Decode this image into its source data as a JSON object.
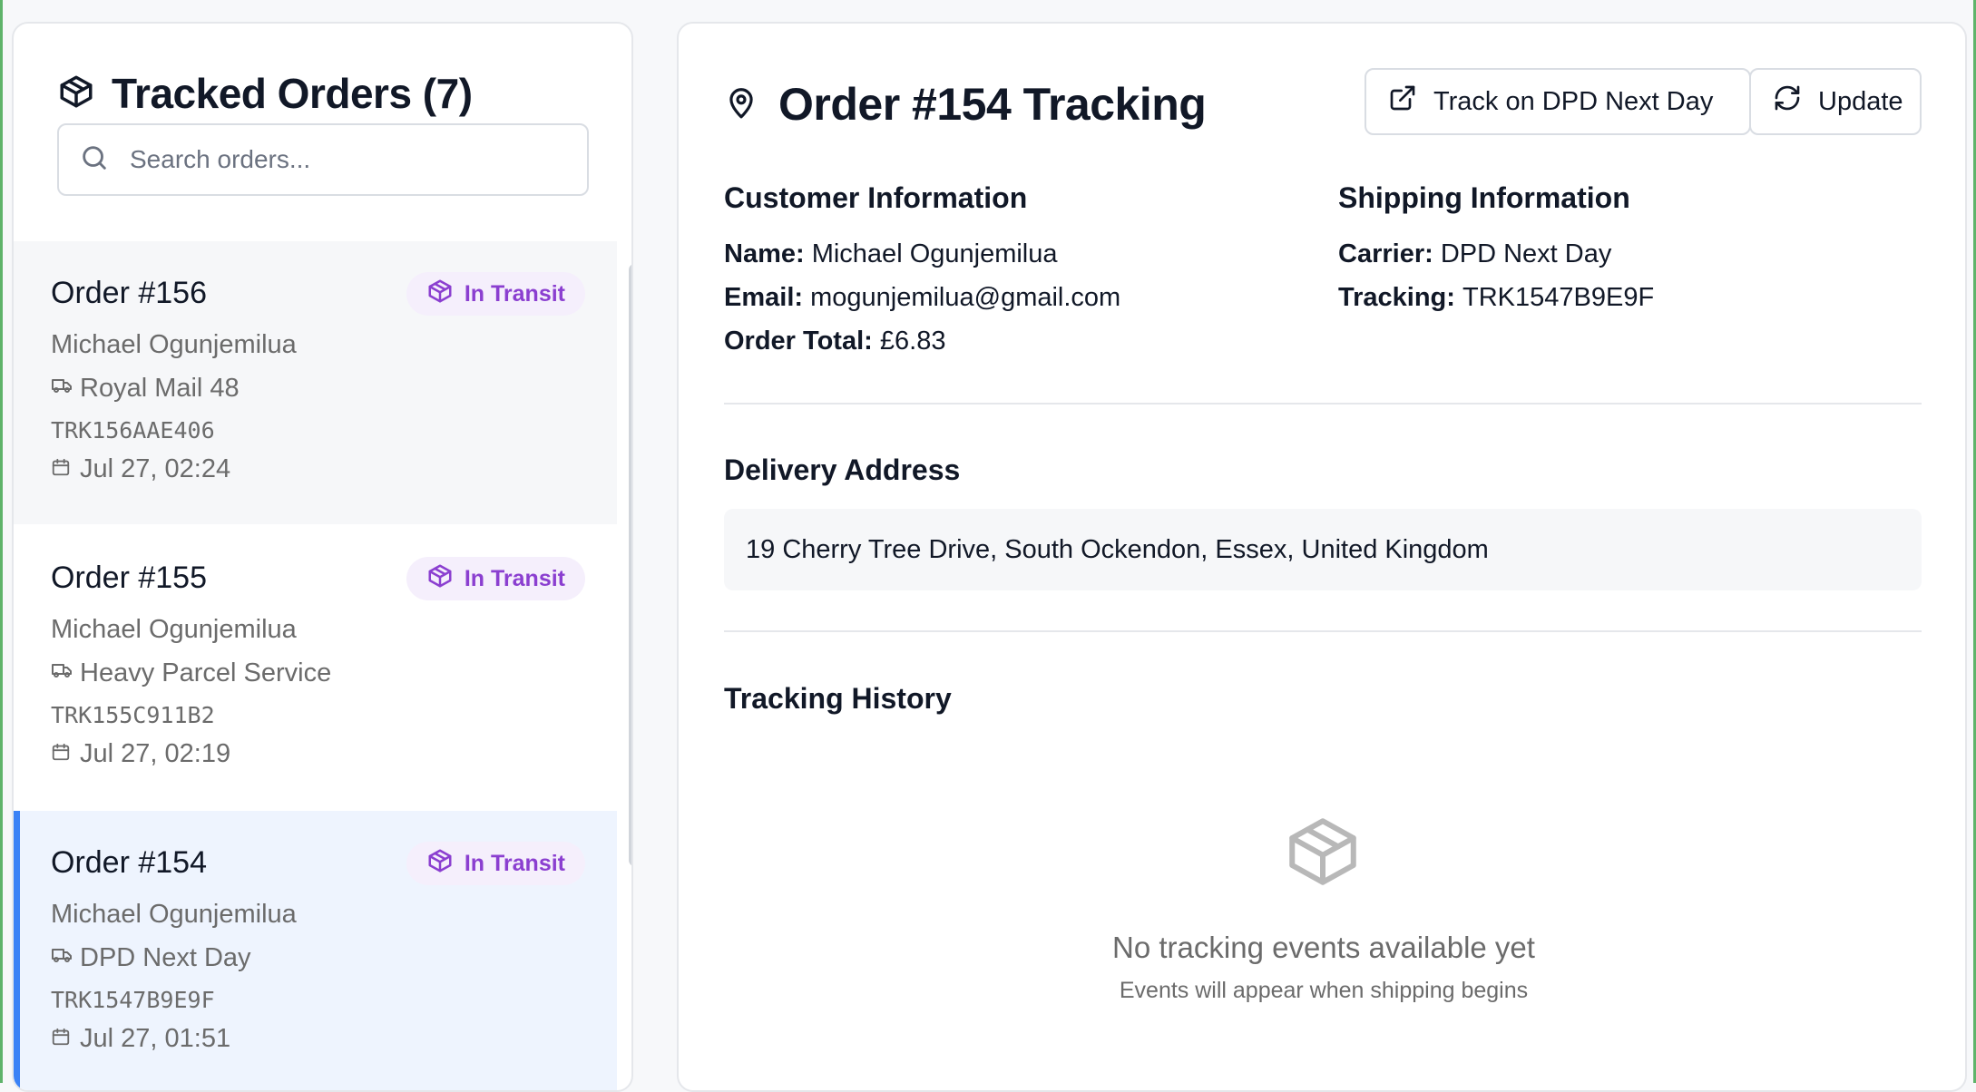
{
  "sidebar": {
    "title": "Tracked Orders (7)",
    "search_placeholder": "Search orders...",
    "orders": [
      {
        "number": "Order #156",
        "status": "In Transit",
        "customer": "Michael Ogunjemilua",
        "carrier": "Royal Mail 48",
        "tracking": "TRK156AAE406",
        "date": "Jul 27, 02:24"
      },
      {
        "number": "Order #155",
        "status": "In Transit",
        "customer": "Michael Ogunjemilua",
        "carrier": "Heavy Parcel Service",
        "tracking": "TRK155C911B2",
        "date": "Jul 27, 02:19"
      },
      {
        "number": "Order #154",
        "status": "In Transit",
        "customer": "Michael Ogunjemilua",
        "carrier": "DPD Next Day",
        "tracking": "TRK1547B9E9F",
        "date": "Jul 27, 01:51"
      }
    ]
  },
  "detail": {
    "title": "Order #154 Tracking",
    "track_button": "Track on DPD Next Day",
    "update_button": "Update",
    "customer_section": "Customer Information",
    "name_label": "Name:",
    "name": "Michael Ogunjemilua",
    "email_label": "Email:",
    "email": "mogunjemilua@gmail.com",
    "total_label": "Order Total:",
    "total": "£6.83",
    "shipping_section": "Shipping Information",
    "carrier_label": "Carrier:",
    "carrier": "DPD Next Day",
    "tracking_label": "Tracking:",
    "tracking": "TRK1547B9E9F",
    "address_section": "Delivery Address",
    "address": "19 Cherry Tree Drive, South Ockendon, Essex, United Kingdom",
    "history_section": "Tracking History",
    "empty_title": "No tracking events available yet",
    "empty_subtitle": "Events will appear when shipping begins"
  },
  "colors": {
    "accent": "#3b82f6",
    "status_purple": "#8b3fd0",
    "status_bg": "#f5effc",
    "frame_green": "#5fb36a"
  }
}
